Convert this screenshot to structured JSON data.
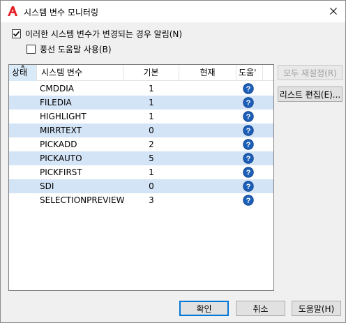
{
  "window": {
    "title": "시스템 변수 모니터링",
    "brand_color": "#e31e24"
  },
  "options": {
    "notify_label": "이러한 시스템 변수가 변경되는 경우 알림(N)",
    "notify_checked": true,
    "balloon_label": "풍선 도움말 사용(B)",
    "balloon_checked": false
  },
  "table": {
    "columns": {
      "status": "상태",
      "name": "시스템 변수",
      "default": "기본",
      "current": "현재",
      "help": "도움'"
    },
    "rows": [
      {
        "name": "CMDDIA",
        "default": "1",
        "current": ""
      },
      {
        "name": "FILEDIA",
        "default": "1",
        "current": ""
      },
      {
        "name": "HIGHLIGHT",
        "default": "1",
        "current": ""
      },
      {
        "name": "MIRRTEXT",
        "default": "0",
        "current": ""
      },
      {
        "name": "PICKADD",
        "default": "2",
        "current": ""
      },
      {
        "name": "PICKAUTO",
        "default": "5",
        "current": ""
      },
      {
        "name": "PICKFIRST",
        "default": "1",
        "current": ""
      },
      {
        "name": "SDI",
        "default": "0",
        "current": ""
      },
      {
        "name": "SELECTIONPREVIEW",
        "default": "3",
        "current": ""
      }
    ],
    "help_icon": "question-circle-icon",
    "alt_row_color": "#d4e4f7",
    "help_icon_color": "#1c5fb8"
  },
  "buttons": {
    "reset_all": "모두 재설정(R)",
    "edit_list": "리스트 편집(E)...",
    "ok": "확인",
    "cancel": "취소",
    "help": "도움말(H)"
  }
}
